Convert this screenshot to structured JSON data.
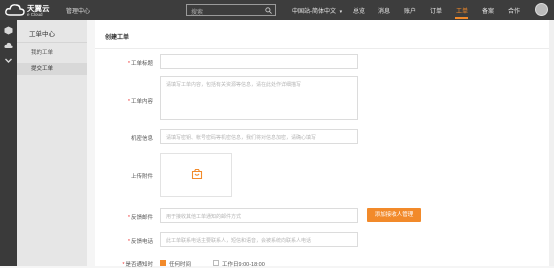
{
  "header": {
    "logo_cn": "天翼云",
    "logo_en": "e Cloud",
    "mgmt": "管理中心",
    "search_placeholder": "搜索",
    "region": "中国站-简体中文",
    "nav": [
      "总览",
      "消息",
      "账户",
      "订单",
      "工单",
      "备案",
      "合作"
    ],
    "active_nav": "工单"
  },
  "sidebar": {
    "title": "工单中心",
    "items": [
      "我的工单",
      "提交工单"
    ],
    "selected": "提交工单"
  },
  "main": {
    "title": "创建工单",
    "fields": {
      "title_label": "工单标题",
      "content_label": "工单内容",
      "content_placeholder": "请填写工单内容，包括有关资源等信息，请在此处作详细描写",
      "sensitive_label": "机密信息",
      "sensitive_placeholder": "请填写密钥、帐号密码等机密信息，我们将对信息加密，请确心填写",
      "attachment_label": "上传附件",
      "email_label": "反馈邮件",
      "email_placeholder": "用于接收其他工单通知的邮件方式",
      "email_button": "添加接收人管理",
      "phone_label": "反馈电话",
      "phone_placeholder": "此工单联系电话主要联系人，短信和语音，会被系统向联系人电话",
      "notify_label": "是否通知时",
      "notify_opt1": "任何时间",
      "notify_opt2": "工作日9:00-18:00"
    }
  },
  "colors": {
    "accent": "#f28a2a",
    "topbar": "#3d3d3d",
    "required": "#e33333"
  }
}
